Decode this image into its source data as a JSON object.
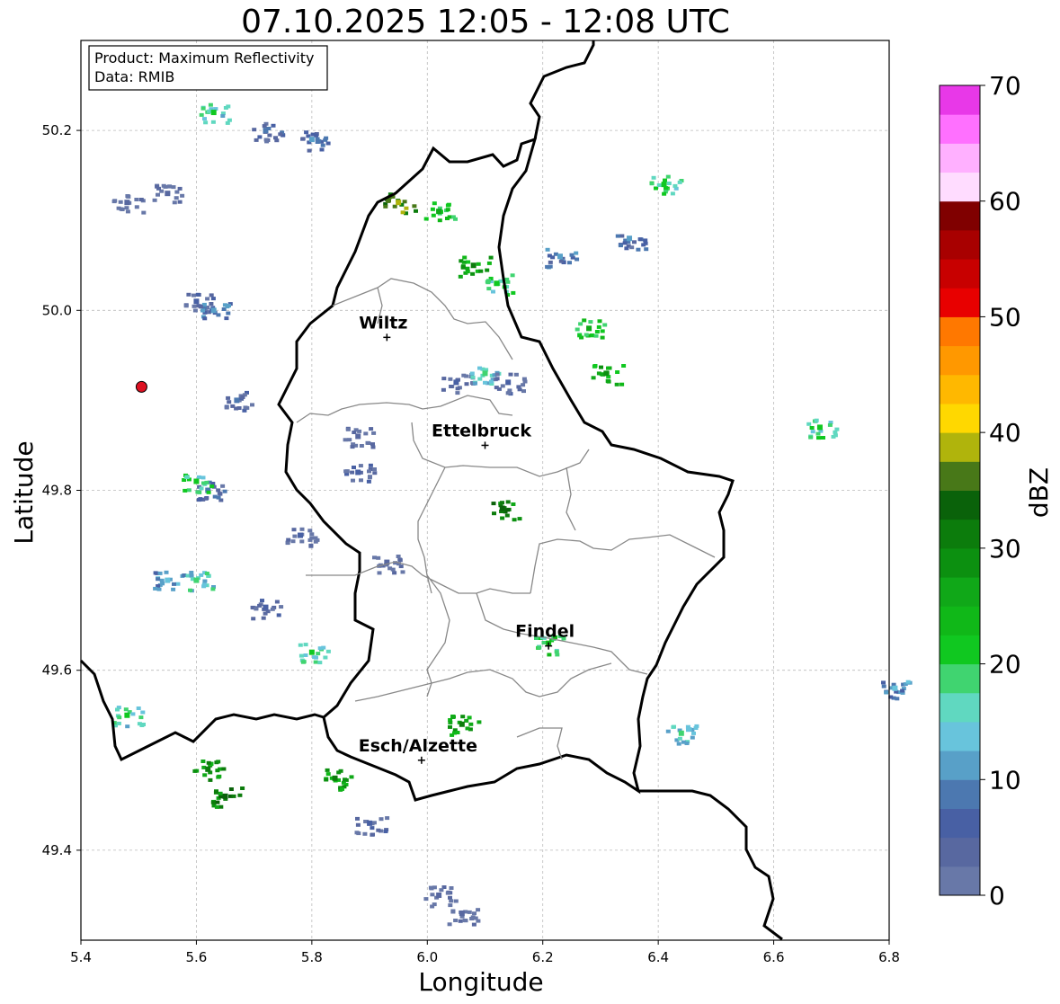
{
  "title": "07.10.2025 12:05 - 12:08 UTC",
  "info": {
    "product": "Product: Maximum Reflectivity",
    "source": "Data: RMIB"
  },
  "axes": {
    "xlabel": "Longitude",
    "ylabel": "Latitude",
    "xticks": [
      5.4,
      5.6,
      5.8,
      6.0,
      6.2,
      6.4,
      6.6,
      6.8
    ],
    "xtick_labels": [
      "5.4",
      "5.6",
      "5.8",
      "6.0",
      "6.2",
      "6.4",
      "6.6",
      "6.8"
    ],
    "yticks": [
      49.4,
      49.6,
      49.8,
      50.0,
      50.2
    ],
    "ytick_labels": [
      "49.4",
      "49.6",
      "49.8",
      "50.0",
      "50.2"
    ],
    "xlim": [
      5.4,
      6.8
    ],
    "ylim": [
      49.3,
      50.3
    ],
    "grid": true
  },
  "cities": [
    {
      "name": "Wiltz",
      "lon": 5.93,
      "lat": 49.97
    },
    {
      "name": "Ettelbruck",
      "lon": 6.1,
      "lat": 49.85
    },
    {
      "name": "Findel",
      "lon": 6.21,
      "lat": 49.627
    },
    {
      "name": "Esch/Alzette",
      "lon": 5.99,
      "lat": 49.5
    }
  ],
  "radar_site": {
    "lon": 5.505,
    "lat": 49.915,
    "color": "#dd1122"
  },
  "colorbar": {
    "label": "dBZ",
    "min": 0,
    "max": 70,
    "ticks": [
      "0",
      "10",
      "20",
      "30",
      "40",
      "50",
      "60",
      "70"
    ],
    "colors": [
      "#6878a8",
      "#5868a0",
      "#4860a4",
      "#4c78b0",
      "#58a0c8",
      "#68c4dc",
      "#60d8c0",
      "#40d470",
      "#10c820",
      "#10b818",
      "#10a818",
      "#0c9010",
      "#0c7c0c",
      "#0a620a",
      "#487818",
      "#b0b40c",
      "#ffd800",
      "#ffb800",
      "#ff9800",
      "#ff7800",
      "#e80000",
      "#c80000",
      "#a80000",
      "#800000",
      "#ffdcff",
      "#ffb0ff",
      "#ff70ff",
      "#e838e8"
    ]
  },
  "echoes": [
    {
      "lon": 5.52,
      "lat": 50.27,
      "dbz": 5
    },
    {
      "lon": 5.48,
      "lat": 50.12,
      "dbz": 3
    },
    {
      "lon": 5.55,
      "lat": 50.13,
      "dbz": 4
    },
    {
      "lon": 5.72,
      "lat": 50.2,
      "dbz": 8
    },
    {
      "lon": 5.63,
      "lat": 50.22,
      "dbz": 20
    },
    {
      "lon": 5.8,
      "lat": 50.19,
      "dbz": 10
    },
    {
      "lon": 5.95,
      "lat": 50.12,
      "dbz": 38
    },
    {
      "lon": 6.02,
      "lat": 50.11,
      "dbz": 25
    },
    {
      "lon": 6.08,
      "lat": 50.05,
      "dbz": 30
    },
    {
      "lon": 6.12,
      "lat": 50.03,
      "dbz": 22
    },
    {
      "lon": 5.6,
      "lat": 50.01,
      "dbz": 6
    },
    {
      "lon": 5.63,
      "lat": 50.0,
      "dbz": 12
    },
    {
      "lon": 5.67,
      "lat": 49.9,
      "dbz": 8
    },
    {
      "lon": 6.05,
      "lat": 49.92,
      "dbz": 5
    },
    {
      "lon": 6.1,
      "lat": 49.93,
      "dbz": 18
    },
    {
      "lon": 6.14,
      "lat": 49.92,
      "dbz": 6
    },
    {
      "lon": 5.88,
      "lat": 49.86,
      "dbz": 4
    },
    {
      "lon": 5.62,
      "lat": 49.8,
      "dbz": 9
    },
    {
      "lon": 5.6,
      "lat": 49.81,
      "dbz": 22
    },
    {
      "lon": 5.78,
      "lat": 49.75,
      "dbz": 5
    },
    {
      "lon": 5.55,
      "lat": 49.7,
      "dbz": 14
    },
    {
      "lon": 5.6,
      "lat": 49.7,
      "dbz": 18
    },
    {
      "lon": 5.72,
      "lat": 49.67,
      "dbz": 6
    },
    {
      "lon": 6.13,
      "lat": 49.78,
      "dbz": 34
    },
    {
      "lon": 6.21,
      "lat": 49.63,
      "dbz": 24
    },
    {
      "lon": 6.31,
      "lat": 49.93,
      "dbz": 28
    },
    {
      "lon": 6.28,
      "lat": 49.98,
      "dbz": 26
    },
    {
      "lon": 6.41,
      "lat": 50.14,
      "dbz": 22
    },
    {
      "lon": 6.68,
      "lat": 49.87,
      "dbz": 22
    },
    {
      "lon": 6.44,
      "lat": 49.53,
      "dbz": 18
    },
    {
      "lon": 6.06,
      "lat": 49.54,
      "dbz": 30
    },
    {
      "lon": 5.62,
      "lat": 49.49,
      "dbz": 32
    },
    {
      "lon": 5.65,
      "lat": 49.46,
      "dbz": 34
    },
    {
      "lon": 6.02,
      "lat": 49.35,
      "dbz": 4
    },
    {
      "lon": 6.06,
      "lat": 49.33,
      "dbz": 3
    },
    {
      "lon": 5.48,
      "lat": 49.55,
      "dbz": 20
    },
    {
      "lon": 5.84,
      "lat": 49.48,
      "dbz": 30
    },
    {
      "lon": 5.9,
      "lat": 49.43,
      "dbz": 6
    },
    {
      "lon": 6.81,
      "lat": 49.58,
      "dbz": 14
    },
    {
      "lon": 6.23,
      "lat": 50.06,
      "dbz": 12
    },
    {
      "lon": 6.35,
      "lat": 50.08,
      "dbz": 10
    },
    {
      "lon": 5.93,
      "lat": 49.72,
      "dbz": 4
    },
    {
      "lon": 5.8,
      "lat": 49.62,
      "dbz": 20
    },
    {
      "lon": 5.88,
      "lat": 49.82,
      "dbz": 6
    }
  ]
}
